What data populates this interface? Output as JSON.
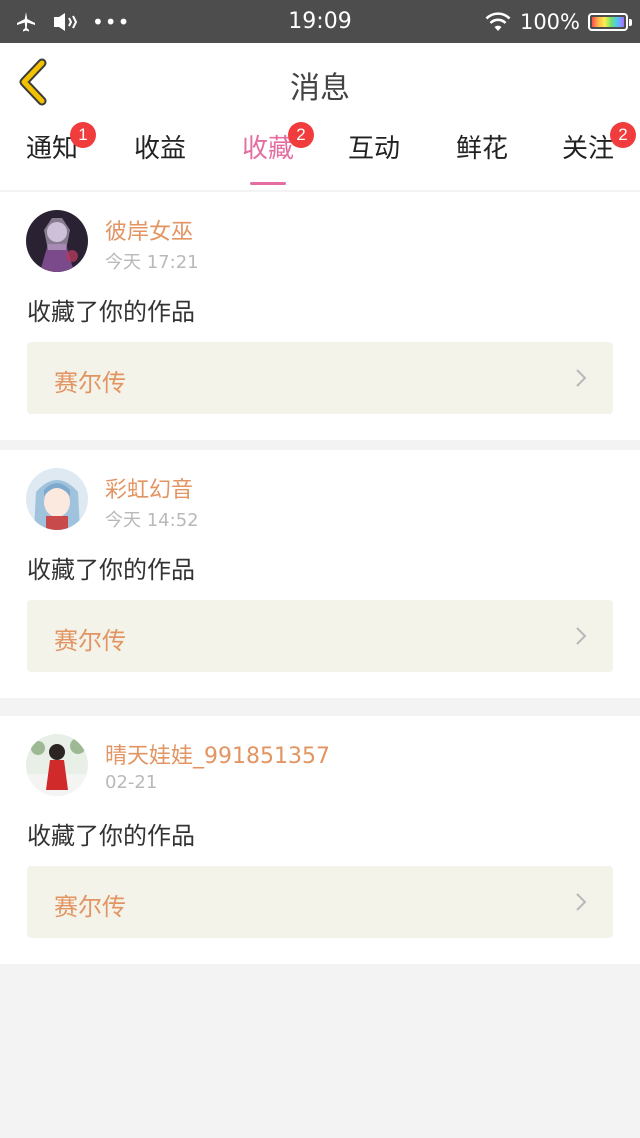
{
  "status_bar": {
    "time": "19:09",
    "battery_percent": "100%",
    "more": "•••"
  },
  "header": {
    "title": "消息"
  },
  "tabs": [
    {
      "label": "通知",
      "badge": "1",
      "active": false
    },
    {
      "label": "收益",
      "badge": "",
      "active": false
    },
    {
      "label": "收藏",
      "badge": "2",
      "active": true
    },
    {
      "label": "互动",
      "badge": "",
      "active": false
    },
    {
      "label": "鲜花",
      "badge": "",
      "active": false
    },
    {
      "label": "关注",
      "badge": "2",
      "active": false
    }
  ],
  "messages": [
    {
      "username": "彼岸女巫",
      "time": "今天 17:21",
      "action": "收藏了你的作品",
      "work_title": "赛尔传"
    },
    {
      "username": "彩虹幻音",
      "time": "今天 14:52",
      "action": "收藏了你的作品",
      "work_title": "赛尔传"
    },
    {
      "username": "晴天娃娃_991851357",
      "time": "02-21",
      "action": "收藏了你的作品",
      "work_title": "赛尔传"
    }
  ],
  "colors": {
    "accent": "#e46ea1",
    "username": "#e29562",
    "badge": "#f03c3c",
    "back_arrow": "#f2c200"
  }
}
